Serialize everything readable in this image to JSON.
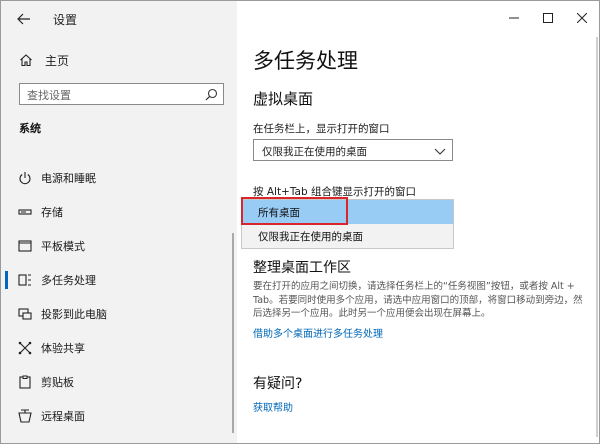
{
  "app": {
    "title": "设置"
  },
  "sidebar": {
    "home_label": "主页",
    "search_placeholder": "查找设置",
    "section_label": "系统",
    "items": [
      {
        "label": "电源和睡眠",
        "icon": "power-icon"
      },
      {
        "label": "存储",
        "icon": "storage-icon"
      },
      {
        "label": "平板模式",
        "icon": "tablet-mode-icon"
      },
      {
        "label": "多任务处理",
        "icon": "multitasking-icon",
        "active": true
      },
      {
        "label": "投影到此电脑",
        "icon": "project-icon"
      },
      {
        "label": "体验共享",
        "icon": "shared-experiences-icon"
      },
      {
        "label": "剪贴板",
        "icon": "clipboard-icon"
      },
      {
        "label": "远程桌面",
        "icon": "remote-desktop-icon"
      }
    ]
  },
  "main": {
    "page_title": "多任务处理",
    "virtual_desktops": {
      "heading": "虚拟桌面",
      "taskbar_label": "在任务栏上，显示打开的窗口",
      "taskbar_value": "仅限我正在使用的桌面",
      "alttab_label": "按 Alt+Tab 组合键显示打开的窗口",
      "dropdown_options": [
        "所有桌面",
        "仅限我正在使用的桌面"
      ],
      "dropdown_selected": "所有桌面"
    },
    "arrange": {
      "heading": "整理桌面工作区",
      "description": "要在打开的应用之间切换，请选择任务栏上的“任务视图”按钮，或者按 Alt + Tab。若要同时使用多个应用，请选中应用窗口的顶部，将窗口移动到旁边，然后选择另一个应用。此时另一个应用便会出现在屏幕上。",
      "link": "借助多个桌面进行多任务处理"
    },
    "help": {
      "heading": "有疑问?",
      "link": "获取帮助"
    }
  },
  "colors": {
    "sidebar_bg": "#f2f2f2",
    "accent": "#0067c0",
    "link": "#0067b8",
    "dropdown_selected": "#99ccf5",
    "annotation_red": "#d9262c"
  }
}
